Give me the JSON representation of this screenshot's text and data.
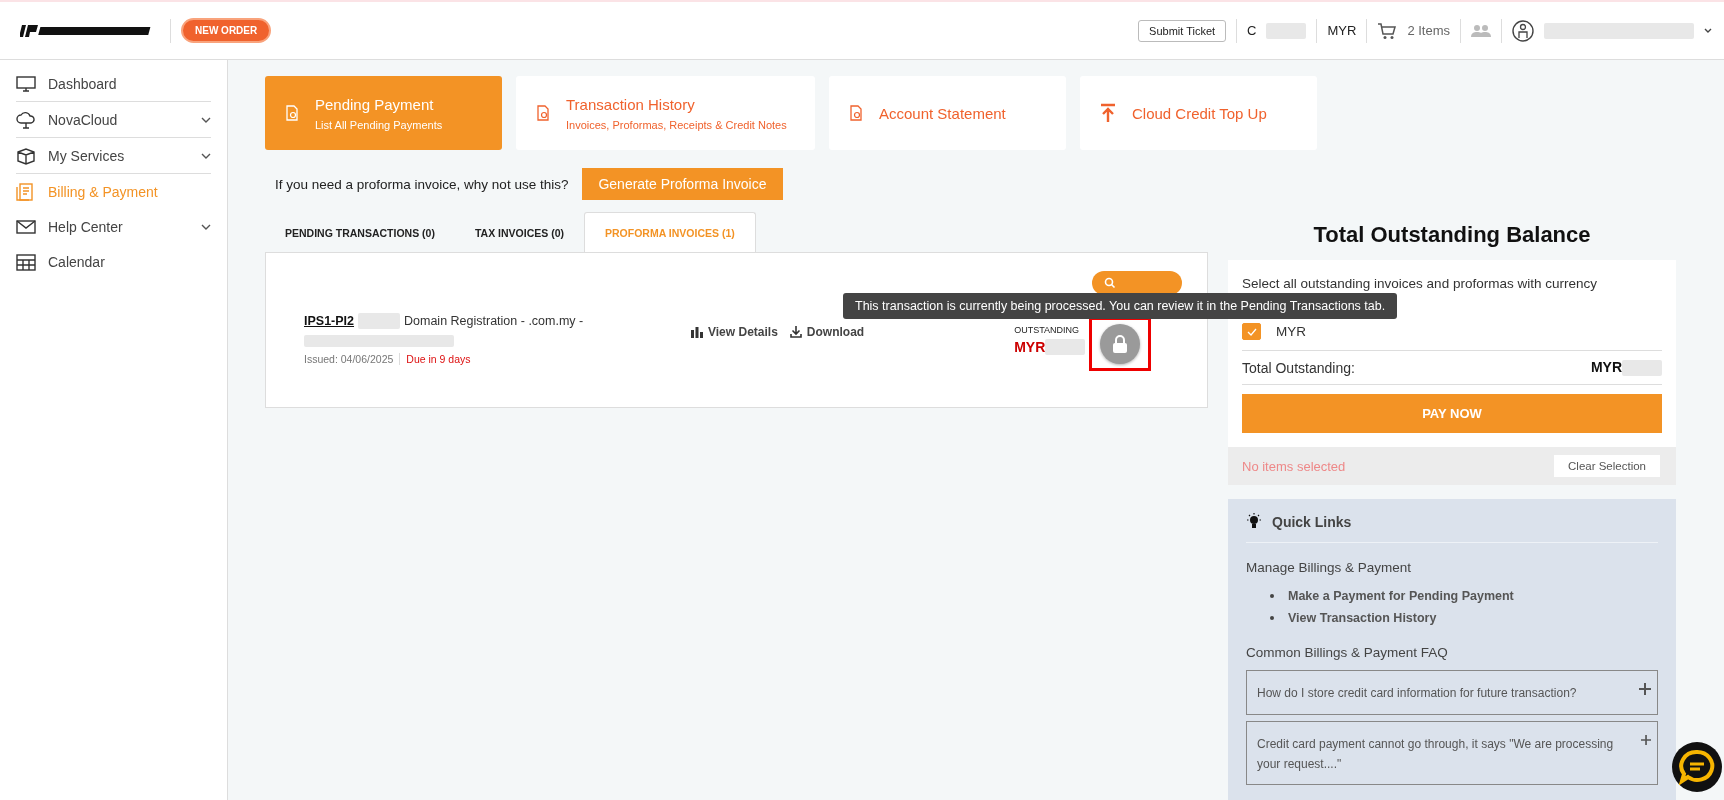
{
  "header": {
    "new_order": "NEW ORDER",
    "submit_ticket": "Submit Ticket",
    "account_initial": "C",
    "currency": "MYR",
    "cart": "2 Items"
  },
  "sidebar": {
    "items": [
      {
        "label": "Dashboard",
        "selected": false,
        "expandable": false
      },
      {
        "label": "NovaCloud",
        "selected": false,
        "expandable": true
      },
      {
        "label": "My Services",
        "selected": false,
        "expandable": true
      },
      {
        "label": "Billing & Payment",
        "selected": true,
        "expandable": false
      },
      {
        "label": "Help Center",
        "selected": false,
        "expandable": true
      },
      {
        "label": "Calendar",
        "selected": false,
        "expandable": false
      }
    ]
  },
  "nav_cards": [
    {
      "title": "Pending Payment",
      "subtitle": "List All Pending Payments",
      "selected": true
    },
    {
      "title": "Transaction History",
      "subtitle": "Invoices, Proformas, Receipts & Credit Notes",
      "selected": false
    },
    {
      "title": "Account Statement",
      "selected": false
    },
    {
      "title": "Cloud Credit Top Up",
      "selected": false
    }
  ],
  "proforma_prompt": {
    "text": "If you need a proforma invoice, why not use this?",
    "button": "Generate Proforma Invoice"
  },
  "tabs": [
    {
      "label": "PENDING TRANSACTIONS (0)",
      "selected": false
    },
    {
      "label": "TAX INVOICES (0)",
      "selected": false
    },
    {
      "label": "PROFORMA INVOICES (1)",
      "selected": true
    }
  ],
  "invoice": {
    "number": "IPS1-PI2",
    "description": "Domain Registration - .com.my -",
    "issued": "Issued: 04/06/2025",
    "due": "Due in 9 days",
    "view_details": "View Details",
    "download": "Download",
    "outstanding_label": "OUTSTANDING",
    "currency": "MYR",
    "locked": true
  },
  "tooltip": "This transaction is currently being processed. You can review it in the Pending Transactions tab.",
  "balance": {
    "title": "Total Outstanding Balance",
    "select_text": "Select all outstanding invoices and proformas with currency",
    "currencies": [
      {
        "label": "MYR",
        "checked": true
      }
    ],
    "total_label": "Total Outstanding:",
    "total_currency": "MYR",
    "pay_button": "PAY NOW",
    "status": "No items selected",
    "clear_button": "Clear Selection"
  },
  "quick_links": {
    "title": "Quick Links",
    "manage_heading": "Manage Billings & Payment",
    "links": [
      "Make a Payment for Pending Payment",
      "View Transaction History"
    ],
    "faq_heading": "Common Billings & Payment FAQ",
    "faq": [
      {
        "question": "How do I store credit card information for future transaction?",
        "expanded": false
      },
      {
        "question": "Credit card payment cannot go through, it says \"We are processing your request....\"",
        "expanded": false
      }
    ]
  }
}
